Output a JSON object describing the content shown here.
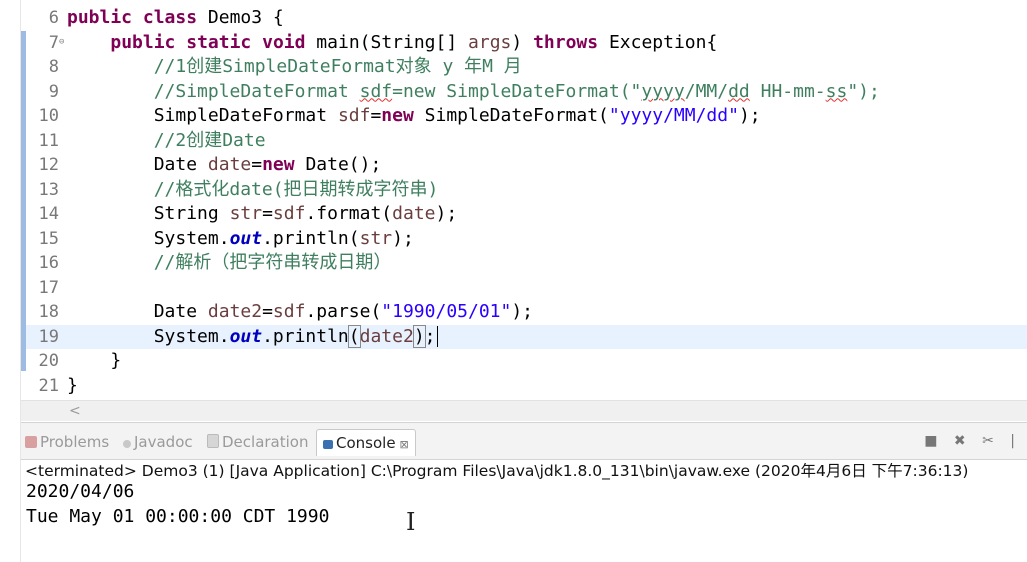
{
  "editor": {
    "current_line": "19",
    "lines": [
      {
        "num": "6",
        "fold": "",
        "segments": [
          {
            "t": "kw",
            "v": "public"
          },
          {
            "t": "pl",
            "v": " "
          },
          {
            "t": "kw",
            "v": "class"
          },
          {
            "t": "pl",
            "v": " Demo3 {"
          }
        ]
      },
      {
        "num": "7",
        "fold": "⊖",
        "segments": [
          {
            "t": "pl",
            "v": "    "
          },
          {
            "t": "kw",
            "v": "public"
          },
          {
            "t": "pl",
            "v": " "
          },
          {
            "t": "kw",
            "v": "static"
          },
          {
            "t": "pl",
            "v": " "
          },
          {
            "t": "kw",
            "v": "void"
          },
          {
            "t": "pl",
            "v": " main(String[] "
          },
          {
            "t": "var",
            "v": "args"
          },
          {
            "t": "pl",
            "v": ") "
          },
          {
            "t": "kw",
            "v": "throws"
          },
          {
            "t": "pl",
            "v": " Exception{"
          }
        ]
      },
      {
        "num": "8",
        "fold": "",
        "segments": [
          {
            "t": "pl",
            "v": "        "
          },
          {
            "t": "cm",
            "v": "//1创建SimpleDateFormat对象 y 年M 月"
          }
        ]
      },
      {
        "num": "9",
        "fold": "",
        "segments": [
          {
            "t": "pl",
            "v": "        "
          },
          {
            "t": "cm",
            "v": "//SimpleDateFormat "
          },
          {
            "t": "cmsq",
            "v": "sdf"
          },
          {
            "t": "cm",
            "v": "=new SimpleDateFormat(\""
          },
          {
            "t": "cmsq",
            "v": "yyyy"
          },
          {
            "t": "cm",
            "v": "/MM/"
          },
          {
            "t": "cmsq",
            "v": "dd"
          },
          {
            "t": "cm",
            "v": " HH-mm-"
          },
          {
            "t": "cmsq",
            "v": "ss"
          },
          {
            "t": "cm",
            "v": "\");"
          }
        ]
      },
      {
        "num": "10",
        "fold": "",
        "segments": [
          {
            "t": "pl",
            "v": "        SimpleDateFormat "
          },
          {
            "t": "var",
            "v": "sdf"
          },
          {
            "t": "pl",
            "v": "="
          },
          {
            "t": "kw",
            "v": "new"
          },
          {
            "t": "pl",
            "v": " SimpleDateFormat("
          },
          {
            "t": "str",
            "v": "\"yyyy/MM/dd\""
          },
          {
            "t": "pl",
            "v": ");"
          }
        ]
      },
      {
        "num": "11",
        "fold": "",
        "segments": [
          {
            "t": "pl",
            "v": "        "
          },
          {
            "t": "cm",
            "v": "//2创建Date"
          }
        ]
      },
      {
        "num": "12",
        "fold": "",
        "segments": [
          {
            "t": "pl",
            "v": "        Date "
          },
          {
            "t": "var",
            "v": "date"
          },
          {
            "t": "pl",
            "v": "="
          },
          {
            "t": "kw",
            "v": "new"
          },
          {
            "t": "pl",
            "v": " Date();"
          }
        ]
      },
      {
        "num": "13",
        "fold": "",
        "segments": [
          {
            "t": "pl",
            "v": "        "
          },
          {
            "t": "cm",
            "v": "//格式化date(把日期转成字符串)"
          }
        ]
      },
      {
        "num": "14",
        "fold": "",
        "segments": [
          {
            "t": "pl",
            "v": "        String "
          },
          {
            "t": "var",
            "v": "str"
          },
          {
            "t": "pl",
            "v": "="
          },
          {
            "t": "var",
            "v": "sdf"
          },
          {
            "t": "pl",
            "v": ".format("
          },
          {
            "t": "var",
            "v": "date"
          },
          {
            "t": "pl",
            "v": ");"
          }
        ]
      },
      {
        "num": "15",
        "fold": "",
        "segments": [
          {
            "t": "pl",
            "v": "        System."
          },
          {
            "t": "fld",
            "v": "out"
          },
          {
            "t": "pl",
            "v": ".println("
          },
          {
            "t": "var",
            "v": "str"
          },
          {
            "t": "pl",
            "v": ");"
          }
        ]
      },
      {
        "num": "16",
        "fold": "",
        "segments": [
          {
            "t": "pl",
            "v": "        "
          },
          {
            "t": "cm",
            "v": "//解析（把字符串转成日期）"
          }
        ]
      },
      {
        "num": "17",
        "fold": "",
        "segments": []
      },
      {
        "num": "18",
        "fold": "",
        "segments": [
          {
            "t": "pl",
            "v": "        Date "
          },
          {
            "t": "var",
            "v": "date2"
          },
          {
            "t": "pl",
            "v": "="
          },
          {
            "t": "var",
            "v": "sdf"
          },
          {
            "t": "pl",
            "v": ".parse("
          },
          {
            "t": "str",
            "v": "\"1990/05/01\""
          },
          {
            "t": "pl",
            "v": ");"
          }
        ]
      },
      {
        "num": "19",
        "fold": "",
        "segments": [
          {
            "t": "pl",
            "v": "        System."
          },
          {
            "t": "fld",
            "v": "out"
          },
          {
            "t": "pl",
            "v": ".println"
          },
          {
            "t": "br",
            "v": "("
          },
          {
            "t": "var",
            "v": "date2"
          },
          {
            "t": "br",
            "v": ")"
          },
          {
            "t": "pl",
            "v": ";"
          }
        ]
      },
      {
        "num": "20",
        "fold": "",
        "segments": [
          {
            "t": "pl",
            "v": "    }"
          }
        ]
      },
      {
        "num": "21",
        "fold": "",
        "segments": [
          {
            "t": "pl",
            "v": "}"
          }
        ]
      }
    ],
    "scroll_left_glyph": "<"
  },
  "console": {
    "tabs": [
      {
        "label": "Problems",
        "icon": "problems-icon",
        "active": false
      },
      {
        "label": "Javadoc",
        "icon": "javadoc-icon",
        "active": false
      },
      {
        "label": "Declaration",
        "icon": "declaration-icon",
        "active": false
      },
      {
        "label": "Console",
        "icon": "console-icon",
        "active": true,
        "close": "⊠"
      }
    ],
    "tools": "■ ✖ ✂ |",
    "terminated_text": "<terminated> Demo3 (1) [Java Application] C:\\Program Files\\Java\\jdk1.8.0_131\\bin\\javaw.exe (2020年4月6日 下午7:36:13)",
    "output": [
      "2020/04/06",
      "Tue May 01 00:00:00 CDT 1990"
    ]
  },
  "colors": {
    "keyword": "#7f0055",
    "comment": "#3f7f5f",
    "string": "#2a00ff",
    "field": "#0000c0",
    "local_var": "#6a3e3e",
    "current_line_bg": "#e8f2fe"
  }
}
